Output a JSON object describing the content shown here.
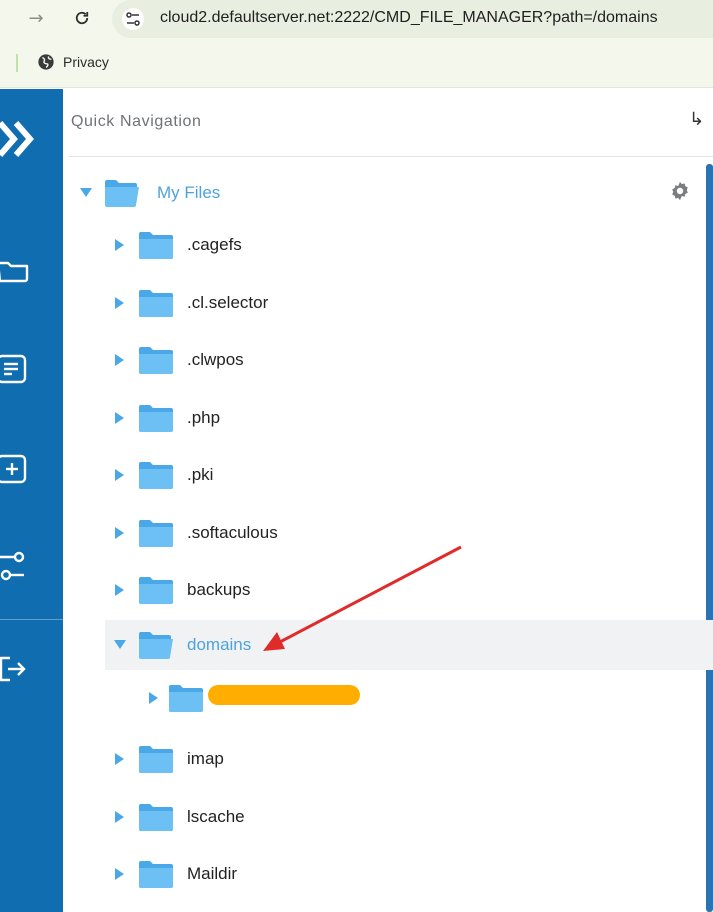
{
  "browser": {
    "url": "cloud2.defaultserver.net:2222/CMD_FILE_MANAGER?path=/domains",
    "bookmark_label": "Privacy",
    "icons": {
      "forward": "forward-arrow-icon",
      "reload": "reload-icon",
      "site_info": "site-settings-icon",
      "bookmark": "globe-icon"
    }
  },
  "sidebar": {
    "items": [
      {
        "icon": "logo-chevron-icon"
      },
      {
        "icon": "folder-icon"
      },
      {
        "icon": "document-icon"
      },
      {
        "icon": "add-box-icon"
      },
      {
        "icon": "connection-icon"
      },
      {
        "icon": "logout-icon"
      }
    ]
  },
  "quick_nav": {
    "title": "Quick Navigation",
    "exit_icon": "return-arrow-icon"
  },
  "tree": {
    "root_label": "My Files",
    "items": [
      {
        "label": ".cagefs"
      },
      {
        "label": ".cl.selector"
      },
      {
        "label": ".clwpos"
      },
      {
        "label": ".php"
      },
      {
        "label": ".pki"
      },
      {
        "label": ".softaculous"
      },
      {
        "label": "backups"
      },
      {
        "label": "domains",
        "expanded": true,
        "selected": true
      },
      {
        "label": "imap"
      },
      {
        "label": "lscache"
      },
      {
        "label": "Maildir"
      }
    ]
  },
  "colors": {
    "sidebar_bg": "#0f6db0",
    "folder": "#4aa8e8",
    "active_text": "#4ea3dd",
    "annotation_arrow": "#e02b2b",
    "redaction": "#ffae00"
  }
}
